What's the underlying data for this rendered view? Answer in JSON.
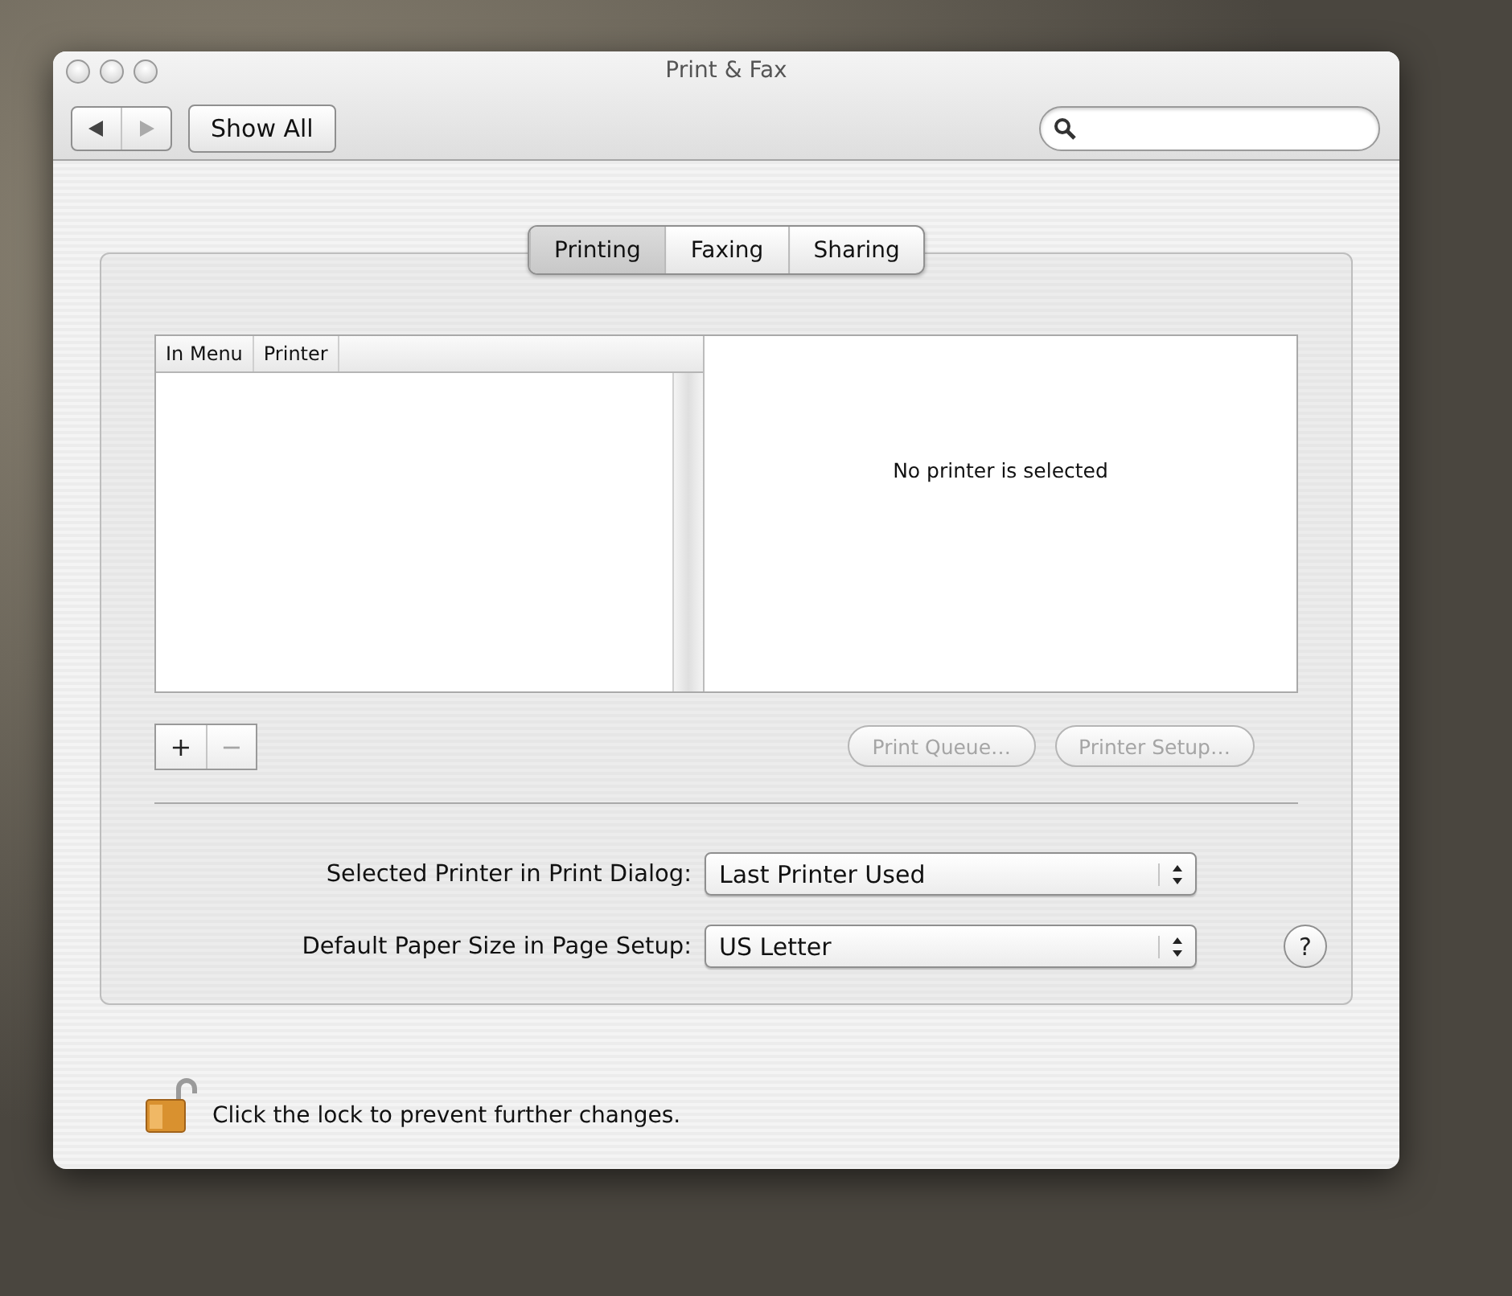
{
  "window": {
    "title": "Print & Fax"
  },
  "toolbar": {
    "show_all": "Show All"
  },
  "tabs": [
    {
      "label": "Printing",
      "selected": true
    },
    {
      "label": "Faxing",
      "selected": false
    },
    {
      "label": "Sharing",
      "selected": false
    }
  ],
  "printer_list": {
    "columns": [
      "In Menu",
      "Printer"
    ]
  },
  "detail": {
    "message": "No printer is selected"
  },
  "list_buttons": [
    {
      "label": "+",
      "disabled": false
    },
    {
      "label": "−",
      "disabled": true
    }
  ],
  "buttons": [
    {
      "label": "Print Queue…",
      "disabled": true
    },
    {
      "label": "Printer Setup…",
      "disabled": true
    }
  ],
  "settings": [
    {
      "label": "Selected Printer in Print Dialog:",
      "value": "Last Printer Used"
    },
    {
      "label": "Default Paper Size in Page Setup:",
      "value": "US Letter"
    }
  ],
  "help": "?",
  "lock": {
    "text": "Click the lock to prevent further changes.",
    "locked": false
  }
}
